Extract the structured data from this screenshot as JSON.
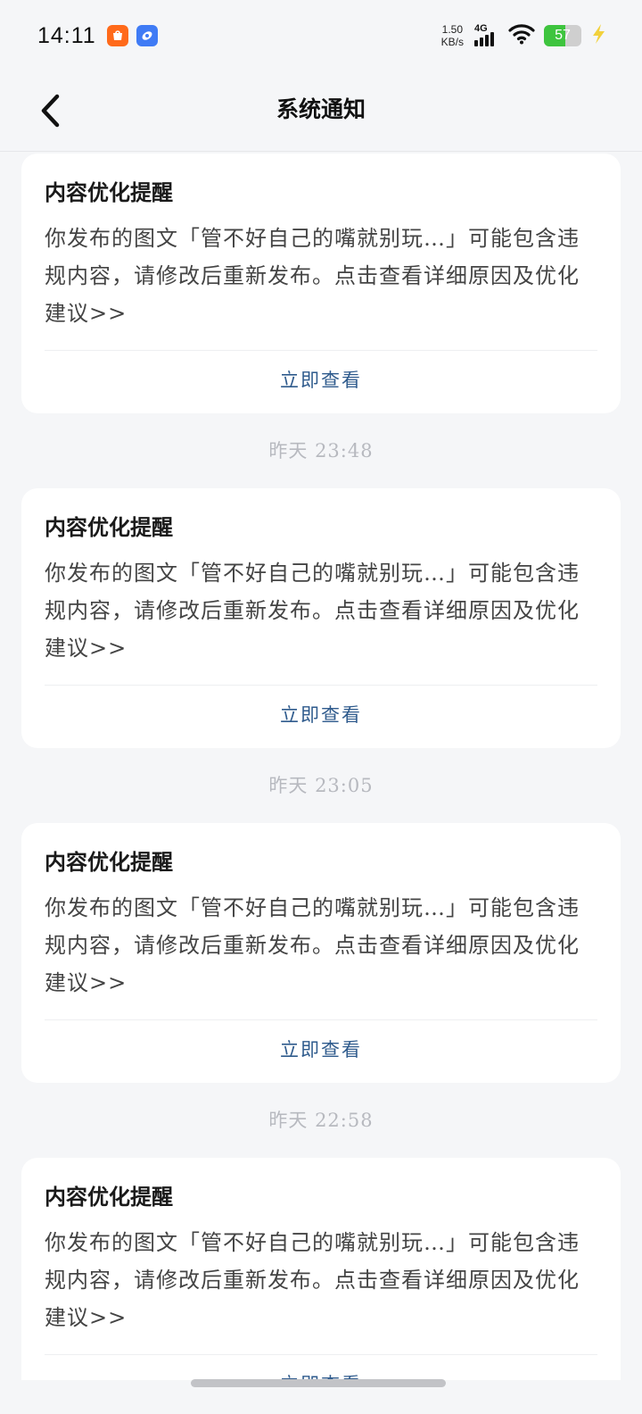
{
  "status_bar": {
    "time": "14:11",
    "net_speed_value": "1.50",
    "net_speed_unit": "KB/s",
    "network_type": "4G",
    "battery": "57",
    "battery_level": 0.57,
    "colors": {
      "battery": "#3ec43e",
      "charging": "#f2d13c",
      "app_orange": "#ff6a1a",
      "app_blue": "#3f7bf5"
    }
  },
  "nav": {
    "title": "系统通知",
    "back_icon": "chevron-left-icon"
  },
  "feed": {
    "items": [
      {
        "time": "",
        "title": "内容优化提醒",
        "body": "你发布的图文「管不好自己的嘴就别玩…」可能包含违规内容，请修改后重新发布。点击查看详细原因及优化建议>>",
        "action": "立即查看"
      },
      {
        "time": "昨天  23:48",
        "title": "内容优化提醒",
        "body": "你发布的图文「管不好自己的嘴就别玩…」可能包含违规内容，请修改后重新发布。点击查看详细原因及优化建议>>",
        "action": "立即查看"
      },
      {
        "time": "昨天  23:05",
        "title": "内容优化提醒",
        "body": "你发布的图文「管不好自己的嘴就别玩…」可能包含违规内容，请修改后重新发布。点击查看详细原因及优化建议>>",
        "action": "立即查看"
      },
      {
        "time": "昨天  22:58",
        "title": "内容优化提醒",
        "body": "你发布的图文「管不好自己的嘴就别玩…」可能包含违规内容，请修改后重新发布。点击查看详细原因及优化建议>>",
        "action": "立即查看"
      }
    ],
    "colors": {
      "action": "#2f5b8d",
      "time": "#b7b9bf"
    }
  }
}
